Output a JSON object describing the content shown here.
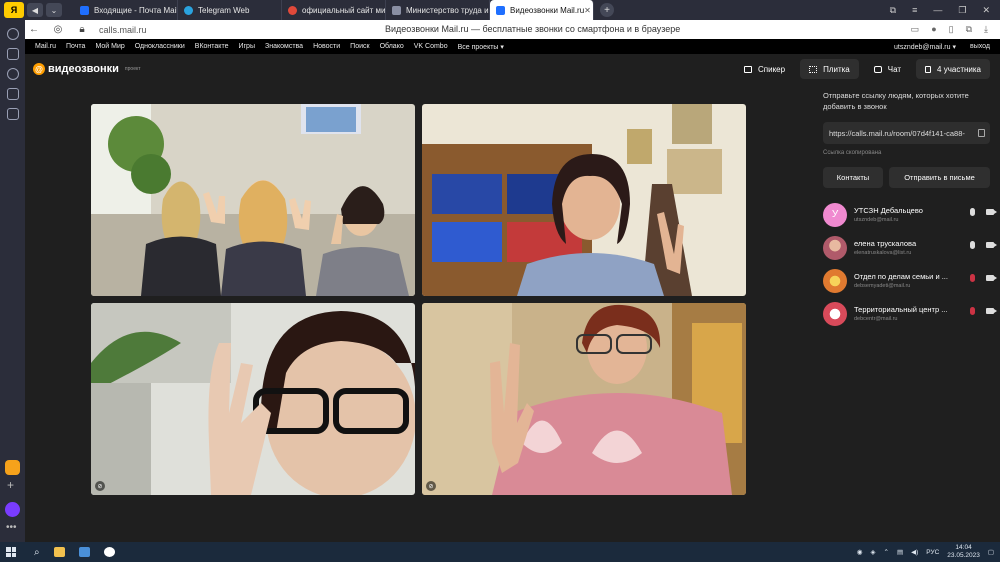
{
  "browser": {
    "tabs": [
      {
        "label": "Входящие - Почта Mail.ru",
        "color": "#1f6fff"
      },
      {
        "label": "Telegram Web",
        "color": "#2aa3df"
      },
      {
        "label": "официальный сайт мини",
        "color": "#e0493a"
      },
      {
        "label": "Министерство труда и со",
        "color": "#8a8fa3"
      },
      {
        "label": "Видеозвонки Mail.ru",
        "color": "#1f6fff"
      }
    ],
    "url": "calls.mail.ru",
    "page_title": "Видеозвонки Mail.ru — бесплатные звонки со смартфона и в браузере"
  },
  "portal_nav": {
    "links": [
      "Mail.ru",
      "Почта",
      "Мой Мир",
      "Одноклассники",
      "ВКонтакте",
      "Игры",
      "Знакомства",
      "Новости",
      "Поиск",
      "Облако",
      "VK Combo",
      "Все проекты ▾"
    ],
    "user": "utszndeb@mail.ru ▾",
    "logout": "выход"
  },
  "app": {
    "logo_text": "видеозвонки",
    "logo_sub": "проект",
    "views": {
      "speaker": "Спикер",
      "tile": "Плитка",
      "chat": "Чат",
      "participants": "4 участника"
    }
  },
  "panel": {
    "invite_text": "Отправьте ссылку людям, которых хотите добавить в звонок",
    "link": "https://calls.mail.ru/room/07d4f141-ca88-",
    "copied": "Ссылка скопирована",
    "contacts_button": "Контакты",
    "send_button": "Отправить в письме",
    "participants": [
      {
        "name": "УТСЗН Дебальцево",
        "email": "utszndeb@mail.ru",
        "avatar_letter": "У",
        "avatar_color": "#f08ad0",
        "mic_on": true
      },
      {
        "name": "елена трускалова",
        "email": "elenatruskalova@list.ru",
        "avatar_letter": "",
        "avatar_color": "#b05a6a",
        "mic_on": true
      },
      {
        "name": "Отдел по делам семьи и ...",
        "email": "debsemyadeti@mail.ru",
        "avatar_letter": "",
        "avatar_color": "#e07a30",
        "mic_on": false
      },
      {
        "name": "Территориальный центр ...",
        "email": "debcentr@mail.ru",
        "avatar_letter": "",
        "avatar_color": "#d84a5a",
        "mic_on": false
      }
    ]
  },
  "taskbar": {
    "lang": "РУС",
    "time": "14:04",
    "date": "23.05.2023"
  }
}
